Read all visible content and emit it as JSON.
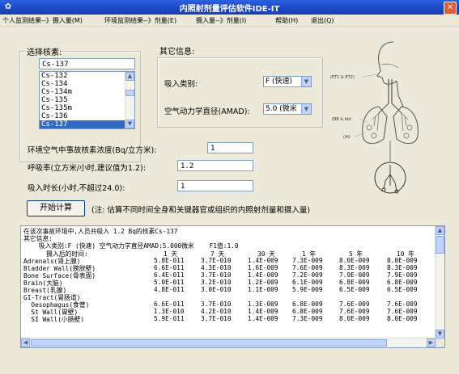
{
  "window": {
    "title": "内照射剂量评估软件IDE-IT"
  },
  "menu": [
    "个人监测结果--》摄入量(M)",
    "环境监测结果--》剂量(E)",
    "摄入量--》剂量(I)",
    "帮助(H)",
    "退出(Q)"
  ],
  "nuclide_group": {
    "label": "选择核素:",
    "selected": "Cs-137",
    "list": [
      "Cs-132",
      "Cs-134",
      "Cs-134m",
      "Cs-135",
      "Cs-135m",
      "Cs-136",
      "Cs-137"
    ]
  },
  "other_group": {
    "label": "其它信息:",
    "intake_type_label": "吸入类别:",
    "intake_type_value": "F (快速)",
    "amad_label": "空气动力学直径(AMAD):",
    "amad_value": "5.0 (微米"
  },
  "params": {
    "concentration_label": "环境空气中事故核素浓度(Bq/立方米):",
    "concentration_value": "1",
    "breathing_label": "呼吸率(立方米/小时,建议值为1.2):",
    "breathing_value": "1.2",
    "duration_label": "吸入时长(小时,不超过24.0):",
    "duration_value": "1"
  },
  "start_button": "开始计算",
  "note": "(注: 估算不同时间全身和关键器官或组织的内照射剂量和摄入量)",
  "output": {
    "line1": "在该次事故环境中,人员共吸入 1.2 Bq的核素Cs-137",
    "line2": "其它信息:",
    "line3": "    吸入类别:F (快速) 空气动力学直径AMAD:5.000微米    F1值:1.0",
    "header": {
      "label": "      摄入后的时间:",
      "cols": [
        "1 天",
        "7 天",
        "30 天",
        "1 年",
        "5 年",
        "10 年"
      ]
    },
    "rows": [
      {
        "name": "Adrenals(肾上腺)",
        "vals": [
          "5.8E-011",
          "3.7E-010",
          "1.4E-009",
          "7.3E-009",
          "8.0E-009",
          "8.0E-009"
        ]
      },
      {
        "name": "Bladder Wall(膀胱壁)",
        "vals": [
          "6.6E-011",
          "4.3E-010",
          "1.6E-009",
          "7.6E-009",
          "8.3E-009",
          "8.3E-009"
        ]
      },
      {
        "name": "Bone Surface(骨表面)",
        "vals": [
          "6.4E-011",
          "3.7E-010",
          "1.4E-009",
          "7.2E-009",
          "7.9E-009",
          "7.9E-009"
        ]
      },
      {
        "name": "Brain(大脑)",
        "vals": [
          "5.0E-011",
          "3.2E-010",
          "1.2E-009",
          "6.1E-009",
          "6.8E-009",
          "6.8E-009"
        ]
      },
      {
        "name": "Breast(乳腺)",
        "vals": [
          "4.8E-011",
          "3.0E-010",
          "1.1E-009",
          "5.9E-009",
          "6.5E-009",
          "6.5E-009"
        ]
      },
      {
        "name": "GI-Tract(胃肠道)",
        "vals": [
          "",
          "",
          "",
          "",
          "",
          ""
        ]
      },
      {
        "name": "  Oesophagus(食管)",
        "vals": [
          "6.6E-011",
          "3.7E-010",
          "1.3E-009",
          "6.8E-009",
          "7.6E-009",
          "7.6E-009"
        ]
      },
      {
        "name": "  St Wall(胃壁)",
        "vals": [
          "1.3E-010",
          "4.2E-010",
          "1.4E-009",
          "6.8E-009",
          "7.6E-009",
          "7.6E-009"
        ]
      },
      {
        "name": "  SI Wall(小肠壁)",
        "vals": [
          "5.9E-011",
          "3.7E-010",
          "1.4E-009",
          "7.3E-009",
          "8.0E-009",
          "8.0E-009"
        ]
      }
    ]
  },
  "figure_labels": {
    "et": "(ET1 & ET2)",
    "bb": "(BB & bb)",
    "ai": "(AI)"
  },
  "colors": {
    "titlebar": "#1b46c4",
    "selection": "#316ac5"
  }
}
